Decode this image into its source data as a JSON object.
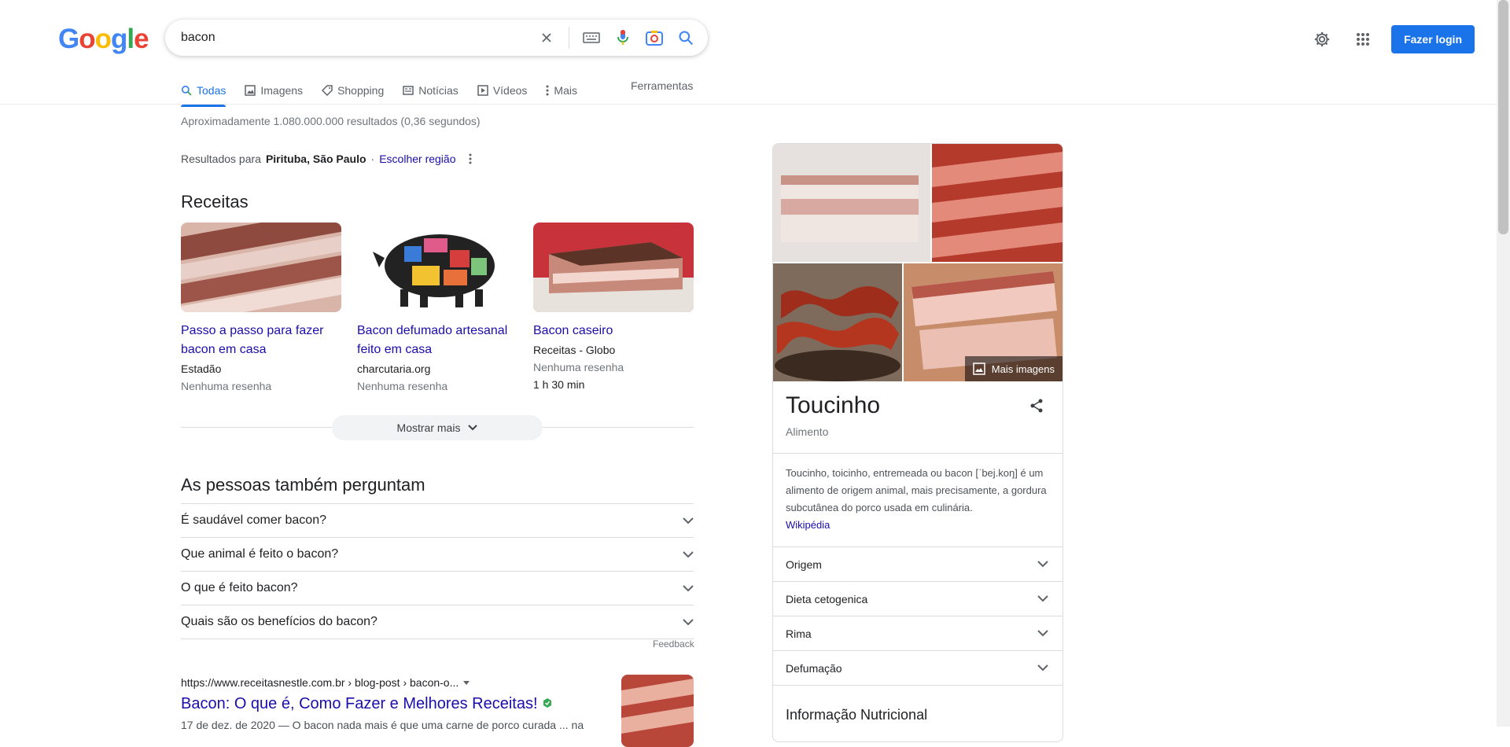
{
  "search": {
    "query": "bacon"
  },
  "header": {
    "login_label": "Fazer login"
  },
  "tabs": [
    {
      "label": "Todas"
    },
    {
      "label": "Imagens"
    },
    {
      "label": "Shopping"
    },
    {
      "label": "Notícias"
    },
    {
      "label": "Vídeos"
    },
    {
      "label": "Mais"
    }
  ],
  "tools_label": "Ferramentas",
  "stats": "Aproximadamente 1.080.000.000 resultados (0,36 segundos)",
  "region": {
    "prefix": "Resultados para",
    "place": "Pirituba, São Paulo",
    "sep": "·",
    "link": "Escolher região"
  },
  "recipes": {
    "heading": "Receitas",
    "items": [
      {
        "title": "Passo a passo para fazer bacon em casa",
        "source": "Estadão",
        "meta": "Nenhuma resenha"
      },
      {
        "title": "Bacon defumado artesanal feito em casa",
        "source": "charcutaria.org",
        "meta": "Nenhuma resenha"
      },
      {
        "title": "Bacon caseiro",
        "source": "Receitas - Globo",
        "meta": "Nenhuma resenha",
        "time": "1 h 30 min"
      }
    ],
    "show_more": "Mostrar mais"
  },
  "paa": {
    "heading": "As pessoas também perguntam",
    "questions": [
      "É saudável comer bacon?",
      "Que animal é feito o bacon?",
      "O que é feito bacon?",
      "Quais são os benefícios do bacon?"
    ],
    "feedback": "Feedback"
  },
  "result": {
    "url": "https://www.receitasnestle.com.br › blog-post › bacon-o...",
    "title": "Bacon: O que é, Como Fazer e Melhores Receitas!",
    "snippet": "17 de dez. de 2020 — O bacon nada mais é que uma carne de porco curada ... na"
  },
  "knowledge_panel": {
    "more_images": "Mais imagens",
    "title": "Toucinho",
    "subtitle": "Alimento",
    "description": "Toucinho, toicinho, entremeada ou bacon [ˈbej.koŋ] é um alimento de origem animal, mais precisamente, a gordura subcutânea do porco usada em culinária.",
    "source": "Wikipédia",
    "rows": [
      "Origem",
      "Dieta cetogenica",
      "Rima",
      "Defumação"
    ],
    "nutrition_heading": "Informação Nutricional"
  },
  "colors": {
    "accent": "#1a73e8",
    "link": "#1a0dab"
  }
}
